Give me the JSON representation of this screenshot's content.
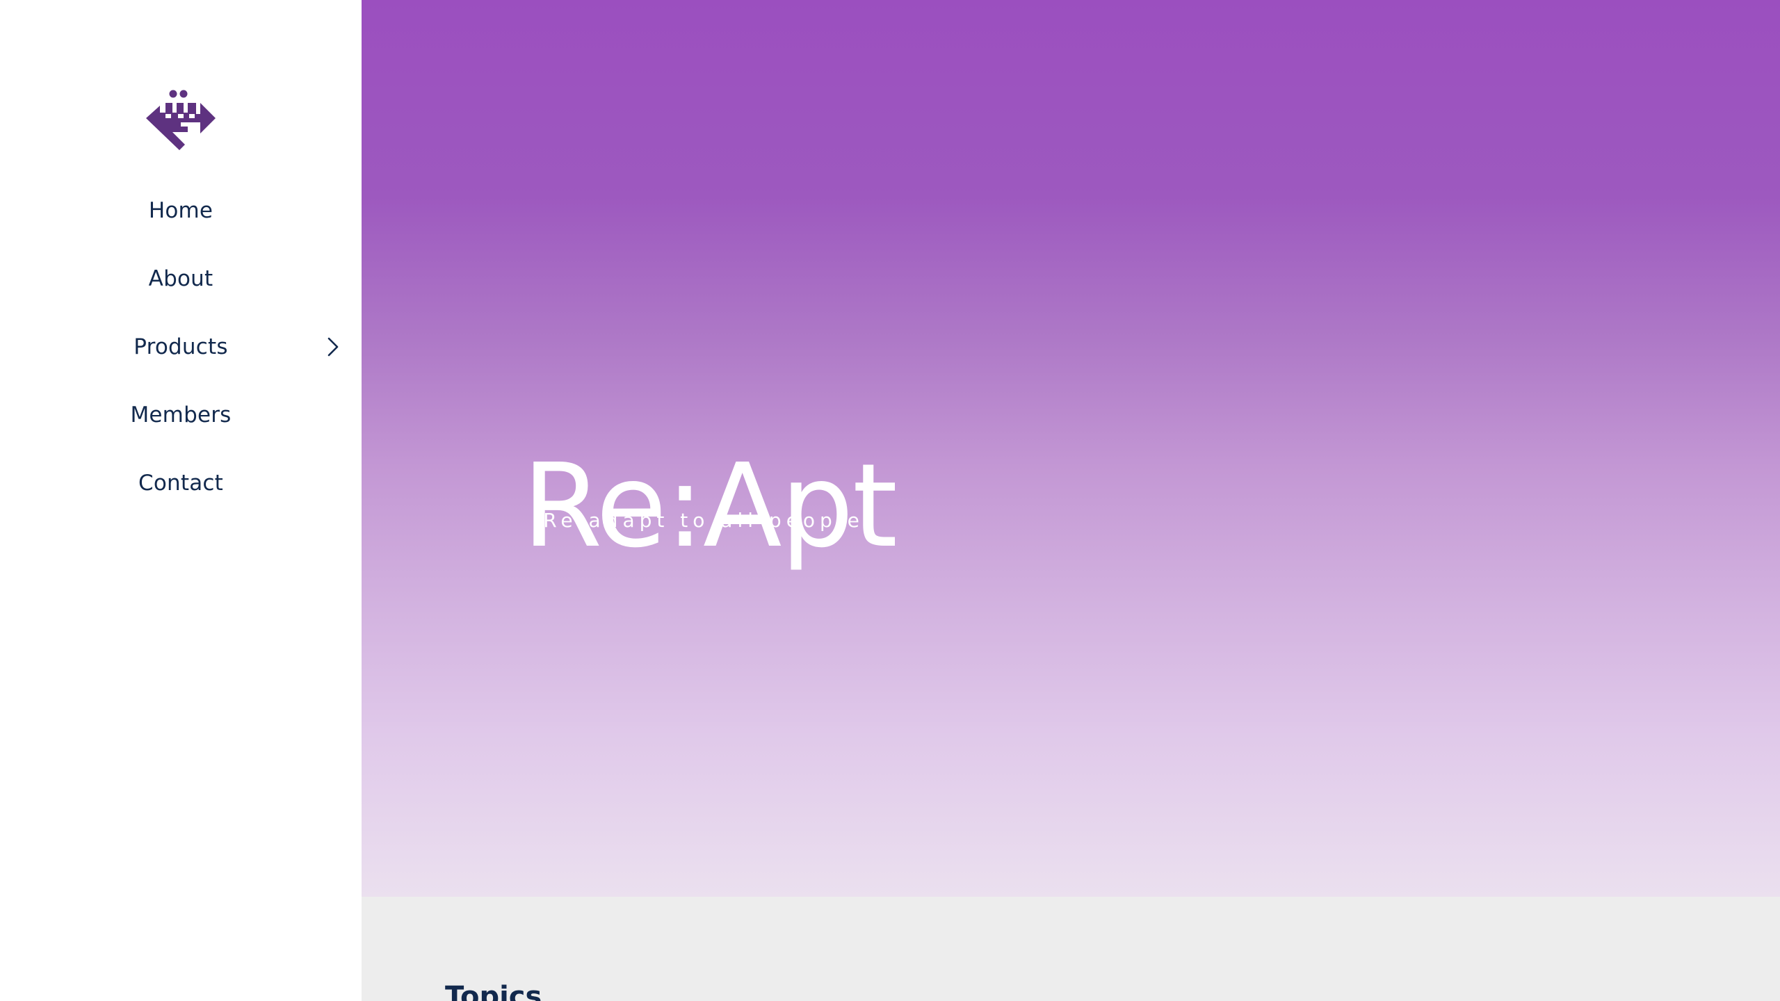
{
  "sidebar": {
    "logo_icon": "reapt-logo-icon",
    "items": [
      {
        "label": "Home"
      },
      {
        "label": "About"
      },
      {
        "label": "Products",
        "icon": "chevron-right-icon"
      },
      {
        "label": "Members"
      },
      {
        "label": "Contact"
      }
    ]
  },
  "hero": {
    "title": "Re:Apt",
    "subtitle": "Re adapt to all people."
  },
  "topics": {
    "heading": "Topics"
  },
  "colors": {
    "brand_purple": "#9b4fbf",
    "logo_purple": "#5e3280",
    "nav_text": "#12294d",
    "section_bg": "#ededed"
  }
}
